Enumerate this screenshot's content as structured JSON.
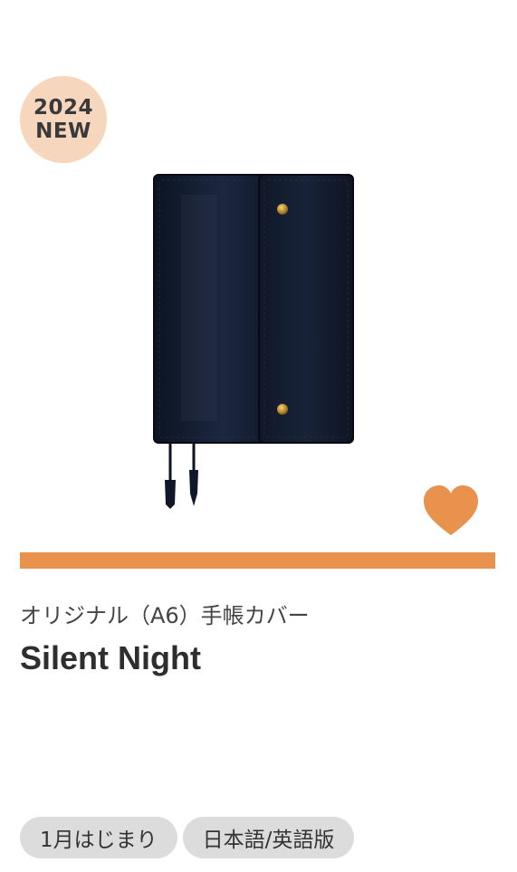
{
  "badge": {
    "year": "2024",
    "label": "NEW"
  },
  "product": {
    "image_icon": "notebook-cover-image",
    "favorite_icon": "heart-icon",
    "category": "オリジナル（A6）手帳カバー",
    "name": "Silent Night",
    "tags": [
      "1月はじまり",
      "日本語/英語版"
    ]
  },
  "colors": {
    "accent": "#e8924d",
    "badge_bg": "#f6d6bd",
    "cover": "#141d2f",
    "tag_bg": "#dcdcdc"
  }
}
